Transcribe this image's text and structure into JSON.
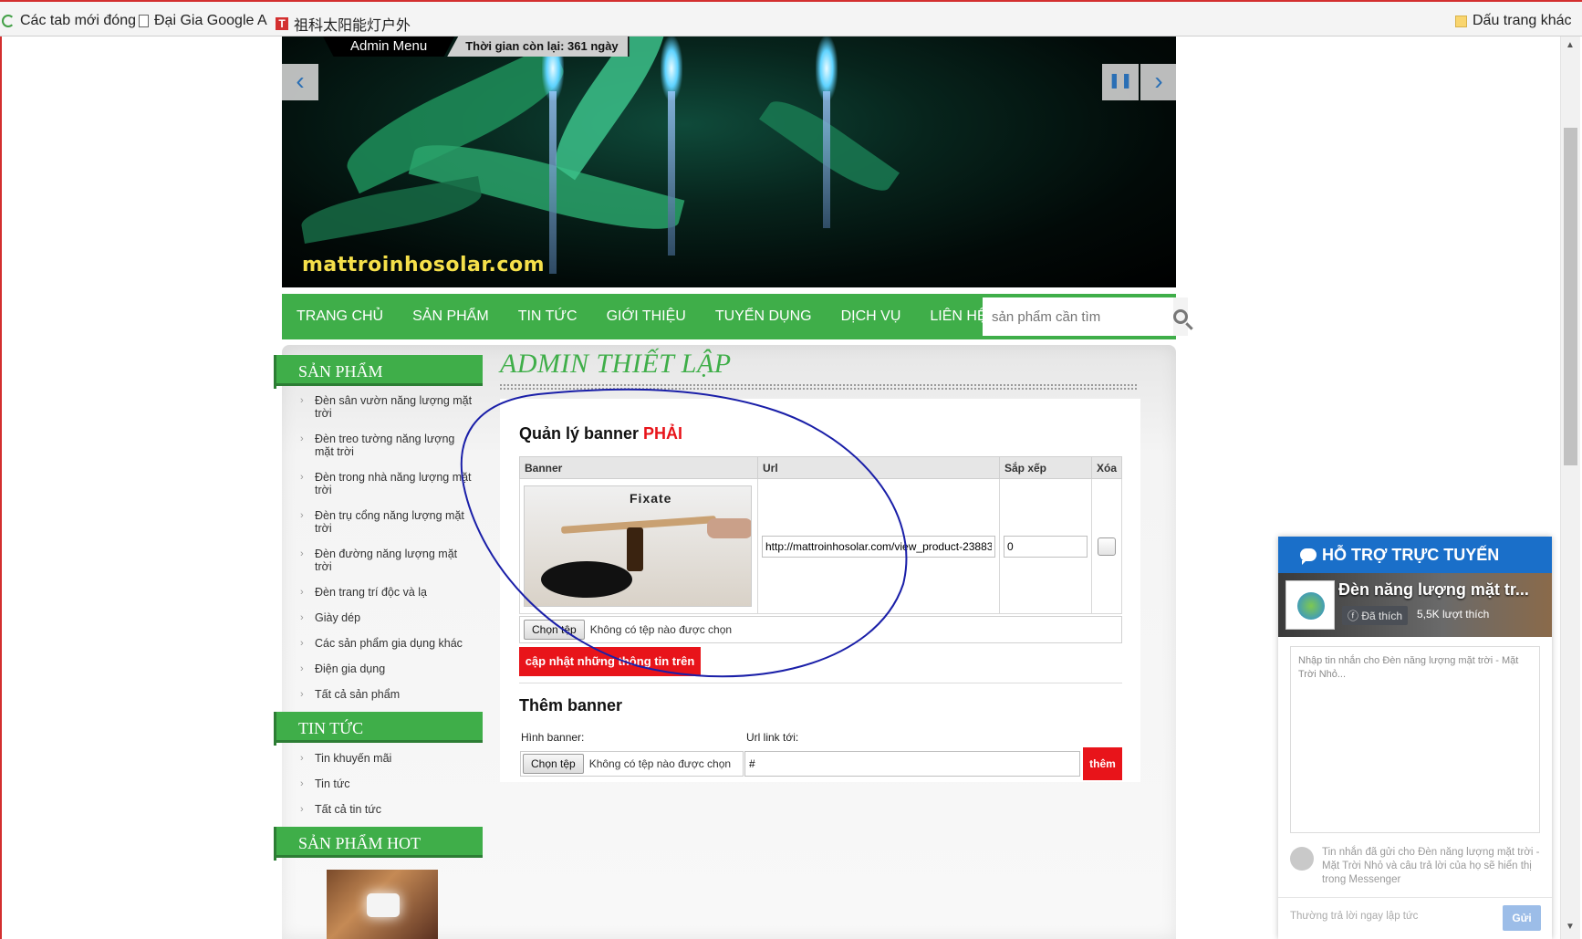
{
  "bookmarks": [
    {
      "icon": "refresh-icon",
      "label": "Các tab mới đóng"
    },
    {
      "icon": "page-icon",
      "label": "Đại Gia Google A"
    },
    {
      "icon": "t-icon",
      "label": "祖科太阳能灯户外"
    },
    {
      "icon": "folder-icon",
      "label": "Dấu trang khác"
    }
  ],
  "banner": {
    "admin_menu": "Admin Menu",
    "timer": "Thời gian còn lại: 361 ngày",
    "brand": "mattroinhosolar.com",
    "prev": "‹",
    "next": "›",
    "pause": "❚❚"
  },
  "nav": {
    "items": [
      "TRANG CHỦ",
      "SẢN PHẨM",
      "TIN TỨC",
      "GIỚI THIỆU",
      "TUYỂN DỤNG",
      "DỊCH VỤ",
      "LIÊN HỆ"
    ],
    "search_placeholder": "sản phẩm cần tìm"
  },
  "sidebar": {
    "products_title": "SẢN PHẨM",
    "products": [
      "Đèn sân vườn năng lượng mặt trời",
      "Đèn treo tường năng lượng mặt trời",
      "Đèn trong nhà năng lượng mặt trời",
      "Đèn trụ cổng năng lượng mặt trời",
      "Đèn đường năng lượng mặt trời",
      "Đèn trang trí độc và lạ",
      "Giày dép",
      "Các sản phẩm gia dụng khác",
      "Điện gia dụng",
      "Tất cả sản phẩm"
    ],
    "news_title": "TIN TỨC",
    "news": [
      "Tin khuyến mãi",
      "Tin tức",
      "Tất cả tin tức"
    ],
    "hot_title": "SẢN PHẨM HOT"
  },
  "main": {
    "title": "ADMIN THIẾT LẬP",
    "manage_prefix": "Quản lý banner ",
    "manage_side": "PHẢI",
    "table": {
      "headers": [
        "Banner",
        "Url",
        "Sắp xếp",
        "Xóa"
      ],
      "row": {
        "image_label": "Fixate",
        "url": "http://mattroinhosolar.com/view_product-23883",
        "sort": "0"
      }
    },
    "file_button": "Chọn tệp",
    "file_status": "Không có tệp nào được chọn",
    "update_button": "cập nhật những thông tin trên",
    "add_title": "Thêm banner",
    "add_image_label": "Hình banner:",
    "add_url_label": "Url link tới:",
    "add_url_value": "#",
    "add_button": "thêm"
  },
  "chat": {
    "title": "HỖ TRỢ TRỰC TUYẾN",
    "page_name": "Đèn năng lượng mặt tr...",
    "liked": "Đã thích",
    "likes": "5,5K lượt thích",
    "message_placeholder": "Nhập tin nhắn cho Đèn năng lượng mặt trời - Mặt Trời Nhỏ...",
    "note": "Tin nhắn đã gửi cho Đèn năng lượng mặt trời - Mặt Trời Nhỏ và câu trả lời của họ sẽ hiển thị trong Messenger",
    "footer": "Thường trả lời ngay lập tức",
    "send": "Gửi"
  },
  "colors": {
    "green": "#3fae49",
    "red": "#e8141a",
    "blue": "#1a6fc9",
    "annotation": "#1a1fa8"
  }
}
